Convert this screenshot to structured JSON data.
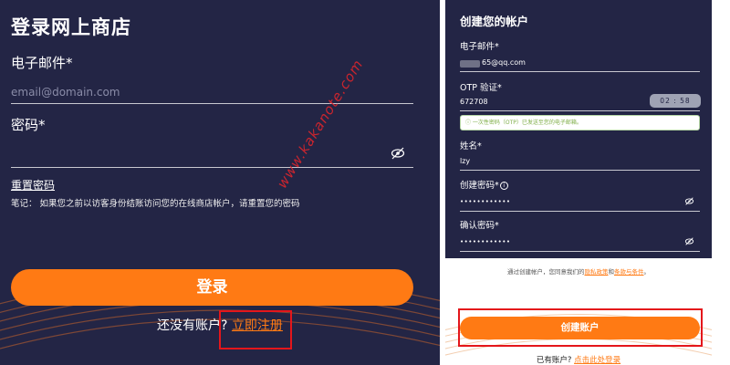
{
  "login": {
    "title": "登录网上商店",
    "email_label": "电子邮件*",
    "email_placeholder": "email@domain.com",
    "password_label": "密码*",
    "reset_link": "重置密码",
    "note": "笔记：  如果您之前以访客身份结账访问您的在线商店帐户，请重置您的密码",
    "login_button": "登录",
    "no_account_text": "还没有账户?",
    "register_link": "立即注册",
    "eye_icon": "eye-off-icon"
  },
  "watermark": "www.kakanote.com",
  "register": {
    "title": "创建您的帐户",
    "email_label": "电子邮件*",
    "email_value": "65@qq.com",
    "otp_label": "OTP 验证*",
    "otp_value": "672708",
    "timer": "02 : 58",
    "otp_notice": "ⓘ 一次性密码（OTP）已发送至您的电子邮箱。",
    "name_label": "姓名*",
    "name_value": "lzy",
    "create_pwd_label": "创建密码*",
    "create_pwd_info": "i",
    "create_pwd_value": "••••••••••••",
    "confirm_pwd_label": "确认密码*",
    "confirm_pwd_value": "••••••••••••",
    "terms_prefix": "通过创建帐户，您同意我们的",
    "privacy_link": "隐私政策",
    "terms_and": "和",
    "terms_link": "条款与条件",
    "terms_suffix": "。",
    "create_button": "创建账户",
    "have_account_text": "已有账户?",
    "login_link": "点击此处登录"
  },
  "colors": {
    "panel_bg": "#232545",
    "accent": "#ff7a14",
    "highlight_box": "#e4161b"
  }
}
